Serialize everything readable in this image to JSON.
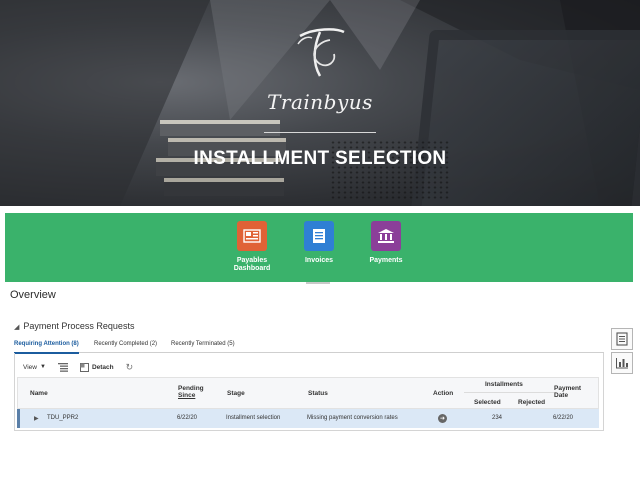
{
  "banner": {
    "brand_name": "Trainbyus",
    "title": "INSTALLMENT SELECTION"
  },
  "nav": {
    "tiles": [
      {
        "label_line1": "Payables",
        "label_line2": "Dashboard",
        "icon": "dashboard-icon",
        "color": "#e06236"
      },
      {
        "label_line1": "Invoices",
        "label_line2": "",
        "icon": "invoices-icon",
        "color": "#2f7fd4"
      },
      {
        "label_line1": "Payments",
        "label_line2": "",
        "icon": "payments-icon",
        "color": "#8b3f99"
      }
    ],
    "band_color": "#3ab26b"
  },
  "overview": {
    "title": "Overview",
    "section_title": "Payment Process Requests",
    "tabs": [
      {
        "label": "Requiring Attention (8)",
        "active": true
      },
      {
        "label": "Recently Completed (2)",
        "active": false
      },
      {
        "label": "Recently Terminated (5)",
        "active": false
      }
    ],
    "toolbar": {
      "view_label": "View",
      "detach_label": "Detach"
    },
    "columns": {
      "name": "Name",
      "pending_line1": "Pending",
      "pending_line2": "Since",
      "stage": "Stage",
      "status": "Status",
      "action": "Action",
      "installments": "Installments",
      "selected": "Selected",
      "rejected": "Rejected",
      "payment_date_line1": "Payment",
      "payment_date_line2": "Date"
    },
    "rows": [
      {
        "name": "TDU_PPR2",
        "pending_since": "6/22/20",
        "stage": "Installment selection",
        "status": "Missing payment conversion rates",
        "selected": "234",
        "rejected": "",
        "payment_date": "6/22/20"
      }
    ]
  }
}
